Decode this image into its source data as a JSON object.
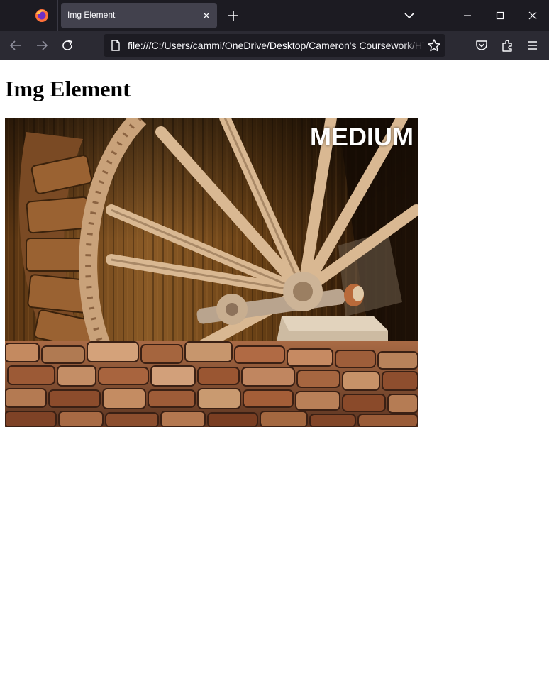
{
  "browser": {
    "tab_title": "Img Element",
    "url": "file:///C:/Users/cammi/OneDrive/Desktop/Cameron's Coursework/HT",
    "icons": [
      "firefox-logo-icon",
      "tab-close-icon",
      "new-tab-icon",
      "list-all-tabs-icon",
      "minimize-icon",
      "maximize-icon",
      "window-close-icon",
      "back-arrow-icon",
      "forward-arrow-icon",
      "reload-icon",
      "page-icon",
      "bookmark-star-icon",
      "pocket-icon",
      "extensions-icon",
      "menu-icon"
    ]
  },
  "page": {
    "heading": "Img Element",
    "image": {
      "alt": "water wheel",
      "overlay_text": "MEDIUM"
    }
  }
}
